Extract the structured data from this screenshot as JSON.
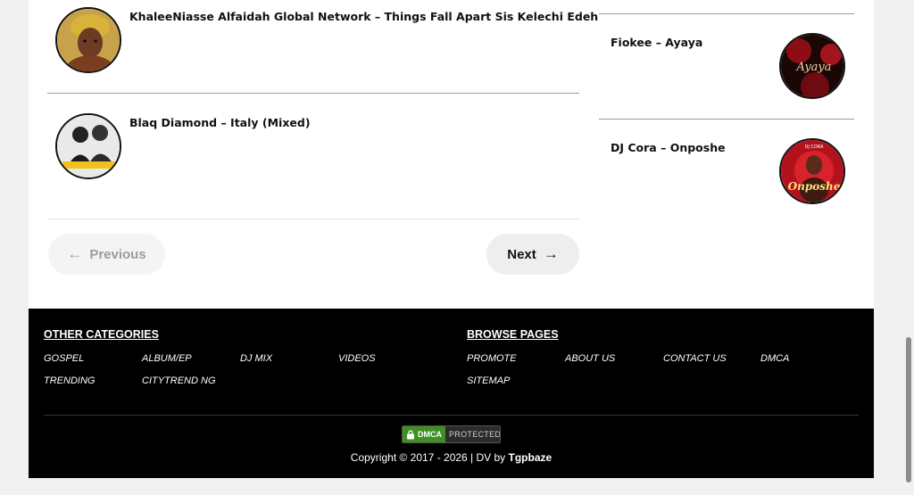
{
  "posts": [
    {
      "title": "KhaleeNiasse Alfaidah Global Network – Things Fall Apart Sis Kelechi Edeh",
      "thumb_icon": "woman-portrait"
    },
    {
      "title": "Blaq Diamond – Italy (Mixed)",
      "thumb_icon": "two-artists-cover"
    }
  ],
  "sidebar": [
    {
      "title": "Fiokee – Ayaya",
      "cover_text": "Ayaya"
    },
    {
      "title": "DJ Cora – Onposhe",
      "cover_text": "Onposhe",
      "cover_top": "DJ CORA"
    }
  ],
  "pagination": {
    "prev_label": "Previous",
    "next_label": "Next",
    "prev_arrow": "←",
    "next_arrow": "→"
  },
  "footer": {
    "categories_heading": "OTHER CATEGORIES",
    "categories": [
      "GOSPEL",
      "ALBUM/EP",
      "DJ MIX",
      "VIDEOS",
      "TRENDING",
      "CITYTREND NG"
    ],
    "pages_heading": "BROWSE PAGES",
    "pages": [
      "PROMOTE",
      "ABOUT US",
      "CONTACT US",
      "DMCA",
      "SITEMAP"
    ],
    "dmca_left": "DMCA",
    "dmca_right": "PROTECTED",
    "copyright_text": "Copyright © 2017 - 2026 | DV by ",
    "copyright_brand": "Tgpbaze"
  },
  "colors": {
    "footer_bg": "#000000",
    "dmca_green": "#3f8f23",
    "cover_red": "#b3121d"
  }
}
